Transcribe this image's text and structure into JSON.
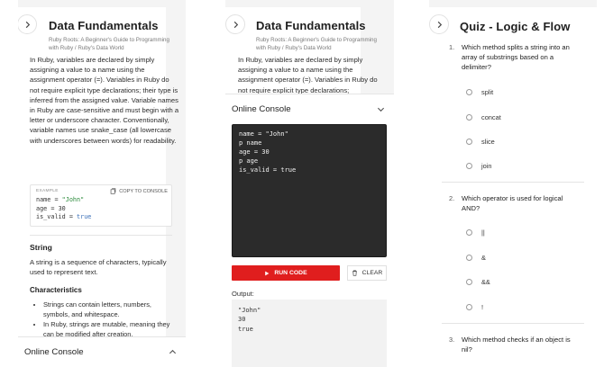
{
  "panel1": {
    "title": "Data Fundamentals",
    "subtitle": "Ruby Roots: A Beginner's Guide to Programming with Ruby / Ruby's Data World",
    "intro": "In Ruby, variables are declared by simply assigning a value to a name using the assignment operator (=). Variables in Ruby do not require explicit type declarations; their type is inferred from the assigned value. Variable names in Ruby are case-sensitive and must begin with a letter or underscore character. Conventionally, variable names use snake_case (all lowercase with underscores between words) for readability.",
    "example": {
      "label": "EXAMPLE",
      "copy_label": "COPY TO CONSOLE",
      "line1_var": "name = ",
      "line1_val": "\"John\"",
      "line2_var": "age = ",
      "line2_val": "30",
      "line3_var": "is_valid = ",
      "line3_val": "true"
    },
    "section_title": "String",
    "section_text": "A string is a sequence of characters, typically used to represent text.",
    "characteristics_title": "Characteristics",
    "bullets": [
      "Strings can contain letters, numbers, symbols, and whitespace.",
      "In Ruby, strings are mutable, meaning they can be modified after creation."
    ],
    "console_title": "Online Console"
  },
  "panel2": {
    "title": "Data Fundamentals",
    "subtitle": "Ruby Roots: A Beginner's Guide to Programming with Ruby / Ruby's Data World",
    "intro": "In Ruby, variables are declared by simply assigning a value to a name using the assignment operator (=). Variables in Ruby do not require explicit type declarations;",
    "console_title": "Online Console",
    "code_lines": [
      "name = \"John\"",
      "p name",
      "age = 30",
      "p age",
      "is_valid = true"
    ],
    "run_label": "RUN CODE",
    "clear_label": "CLEAR",
    "output_label": "Output:",
    "output_lines": [
      "\"John\"",
      "30",
      "true"
    ]
  },
  "panel3": {
    "title": "Quiz - Logic & Flow",
    "questions": [
      {
        "num": "1.",
        "text": "Which method splits a string into an array of substrings based on a delimiter?",
        "options": [
          "split",
          "concat",
          "slice",
          "join"
        ]
      },
      {
        "num": "2.",
        "text": "Which operator is used for logical AND?",
        "options": [
          "||",
          "&",
          "&&",
          "!"
        ]
      },
      {
        "num": "3.",
        "text": "Which method checks if an object is nil?",
        "options": []
      }
    ]
  },
  "colors": {
    "run_button": "#e01e1e",
    "editor_bg": "#2b2b2b",
    "panel_bg": "#f4f4f4"
  }
}
